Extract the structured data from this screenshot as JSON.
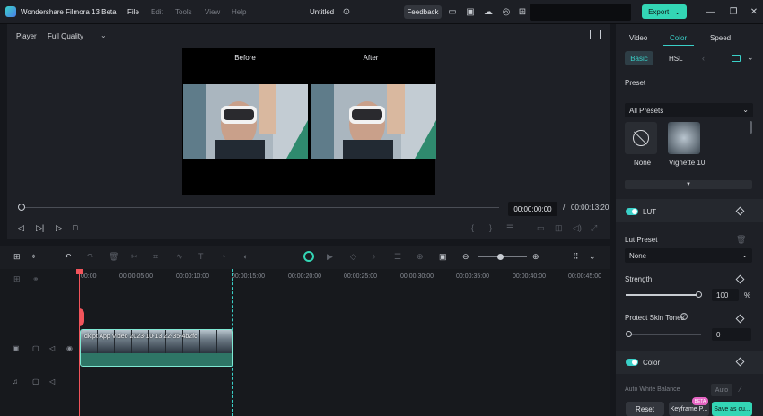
{
  "titlebar": {
    "app_name": "Wondershare Filmora 13 Beta",
    "menu": [
      "File",
      "Edit",
      "Tools",
      "View",
      "Help"
    ],
    "project_title": "Untitled",
    "feedback_label": "Feedback",
    "export_label": "Export"
  },
  "player": {
    "label": "Player",
    "quality": "Full Quality",
    "before_label": "Before",
    "after_label": "After",
    "current_time": "00:00:00:00",
    "separator": "/",
    "total_time": "00:00:13:20"
  },
  "timeline": {
    "ruler": [
      "00:00",
      "00:00:05:00",
      "00:00:10:00",
      "00:00:15:00",
      "00:00:20:00",
      "00:00:25:00",
      "00:00:30:00",
      "00:00:35:00",
      "00:00:40:00",
      "00:00:45:00"
    ],
    "clip_name": "dkipt App Video 2023-10-13 22-35-4b2fc"
  },
  "right_panel": {
    "tabs": [
      "Video",
      "Color",
      "Speed"
    ],
    "sub_tabs": [
      "Basic",
      "HSL"
    ],
    "preset_title": "Preset",
    "preset_select": "All Presets",
    "presets": [
      "None",
      "Vignette 10"
    ],
    "lut_title": "LUT",
    "lut_preset_label": "Lut Preset",
    "lut_preset_value": "None",
    "strength_label": "Strength",
    "strength_value": "100",
    "strength_unit": "%",
    "protect_label": "Protect Skin Tones",
    "protect_value": "0",
    "color_title": "Color",
    "awb_label": "Auto White Balance",
    "awb_button": "Auto",
    "reset_label": "Reset",
    "keyframe_label": "Keyframe P...",
    "beta_badge": "BETA",
    "save_label": "Save as cu..."
  },
  "sliders": {
    "strength_fraction": 1.0,
    "protect_fraction": 0.0
  },
  "colors": {
    "accent": "#33d6b5",
    "playhead": "#f2545b",
    "beta": "#e565c3"
  }
}
